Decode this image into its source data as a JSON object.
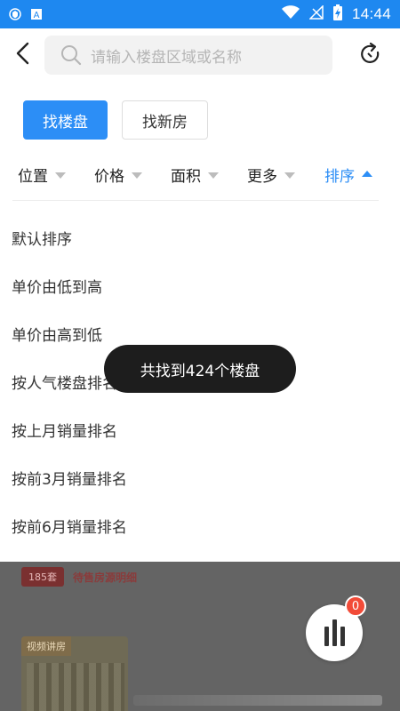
{
  "status_bar": {
    "time": "14:44",
    "icons": [
      "shield-icon",
      "a-badge-icon",
      "wifi-icon",
      "no-signal-icon",
      "battery-charging-icon"
    ]
  },
  "header": {
    "search_placeholder": "请输入楼盘区域或名称"
  },
  "mode_tabs": [
    {
      "label": "找楼盘",
      "active": true
    },
    {
      "label": "找新房",
      "active": false
    }
  ],
  "filters": [
    {
      "label": "位置"
    },
    {
      "label": "价格"
    },
    {
      "label": "面积"
    },
    {
      "label": "更多"
    },
    {
      "label": "排序",
      "active": true
    }
  ],
  "sort_options": [
    "默认排序",
    "单价由低到高",
    "单价由高到低",
    "按人气楼盘排名",
    "按上月销量排名",
    "按前3月销量排名",
    "按前6月销量排名"
  ],
  "toast": "共找到424个楼盘",
  "background": {
    "badge": "185套",
    "badge_label": "待售房源明细",
    "video_label": "视频讲房"
  },
  "fab": {
    "badge_count": "0"
  },
  "colors": {
    "primary": "#2c8ef6",
    "status_bar": "#1e88f0",
    "badge_red": "#f24b38"
  }
}
